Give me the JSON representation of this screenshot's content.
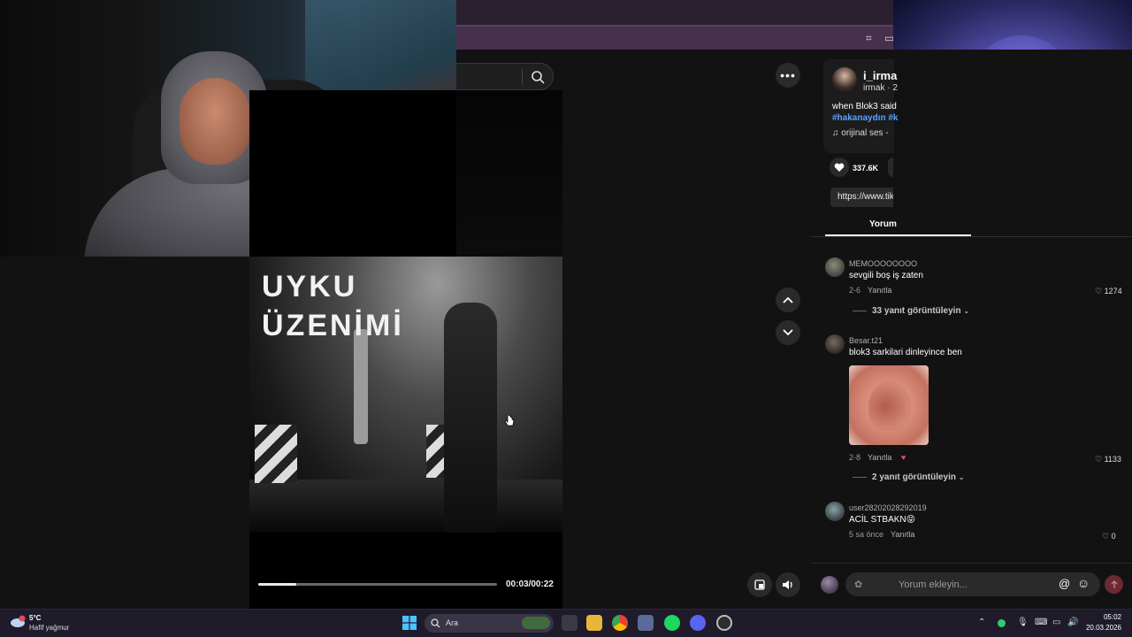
{
  "search": {
    "placeholder": ""
  },
  "video": {
    "banner_line1": "UYKU",
    "banner_line2": "ÜZENİMİ",
    "time": "00:03/00:22",
    "progress_fraction": 0.16
  },
  "post": {
    "author_name": "i_irma",
    "author_sub": "irmak · 2",
    "description": "when Blok3 said",
    "tags": "#hakanaydın #k",
    "sound": "orijinal ses -",
    "like_count": "337.6K",
    "url": "https://www.tik",
    "tab_label": "Yorum"
  },
  "comments": [
    {
      "user": "MEMOOOOOOOO",
      "text": "sevgili boş iş zaten",
      "date": "2-6",
      "reply_label": "Yanıtla",
      "likes": "1274",
      "view_replies": "33 yanıt görüntüleyin"
    },
    {
      "user": "Besar.t21",
      "text": "blok3 sarkilari dinleyince ben",
      "date": "2-8",
      "reply_label": "Yanıtla",
      "likes": "1133",
      "view_replies": "2 yanıt görüntüleyin"
    },
    {
      "user": "user28202028292019",
      "text": "ACİL STBAKN😝",
      "date": "5 sa önce",
      "reply_label": "Yanıtla",
      "likes": "0"
    }
  ],
  "comment_input": {
    "placeholder": "Yorum ekleyin..."
  },
  "taskbar": {
    "weather_temp": "5°C",
    "weather_desc": "Hafif yağmur",
    "search_label": "Ara",
    "time": "05:02",
    "date": "20.03.2026"
  },
  "colors": {
    "accent_link": "#5aa2ff",
    "send_button": "#6b2a32",
    "chrome": "#46304d"
  }
}
